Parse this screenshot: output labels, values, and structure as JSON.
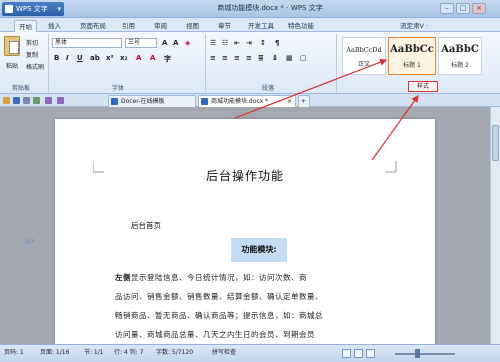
{
  "titlebar": {
    "app_button": "WPS 文字",
    "document_title": "商城功能模块.docx * - WPS 文字"
  },
  "menu": {
    "tabs": [
      "开始",
      "插入",
      "页面布局",
      "引用",
      "审阅",
      "视图",
      "章节",
      "开发工具",
      "特色功能"
    ],
    "active_tab": "开始",
    "right_text": "流定肃V ·"
  },
  "ribbon": {
    "clipboard": {
      "paste": "粘贴",
      "cut": "剪切",
      "copy": "复制",
      "format_painter": "格式刷",
      "group_label": "剪贴板"
    },
    "font": {
      "name_value": "黑体",
      "size_value": "三号",
      "group_label": "字体"
    },
    "paragraph": {
      "group_label": "段落"
    },
    "styles": {
      "items": [
        {
          "sample": "AaBbCcDd",
          "caption": "正文"
        },
        {
          "sample": "AaBbCc",
          "caption": "标题 1"
        },
        {
          "sample": "AaBbC",
          "caption": "标题 2"
        }
      ],
      "group_label": "样式"
    }
  },
  "tabs": {
    "docer_tab": "Docer-在线模板",
    "doc_tab": "商城功能模块.docx *",
    "add_label": "+"
  },
  "document": {
    "heading": "后台操作功能",
    "home_label": "后台首页",
    "function_heading": "功能模块:",
    "para_lines": [
      {
        "bold": "左侧",
        "text": "显示登陆信息、今日统计情况，如：访问次数、商"
      },
      {
        "bold": "",
        "text": "品访问、销售金额、销售数量、结算金额、确认定单数量、"
      },
      {
        "bold": "",
        "text": "畅销商品、暂无商品、确认商品等；提示信息，如：商城总"
      },
      {
        "bold": "",
        "text": "访问量、商城商品总量、几天之内生日的会员、到期会员"
      }
    ]
  },
  "status": {
    "page": "页码: 1",
    "pages": "页面: 1/16",
    "section": "节: 1/1",
    "position": "行: 4  列: 7",
    "words": "字数: 5/7120",
    "spell": "拼写检查"
  },
  "colors": {
    "accent": "#2d6bc0",
    "annotation": "#e03030",
    "selected_style": "#e8872b"
  }
}
